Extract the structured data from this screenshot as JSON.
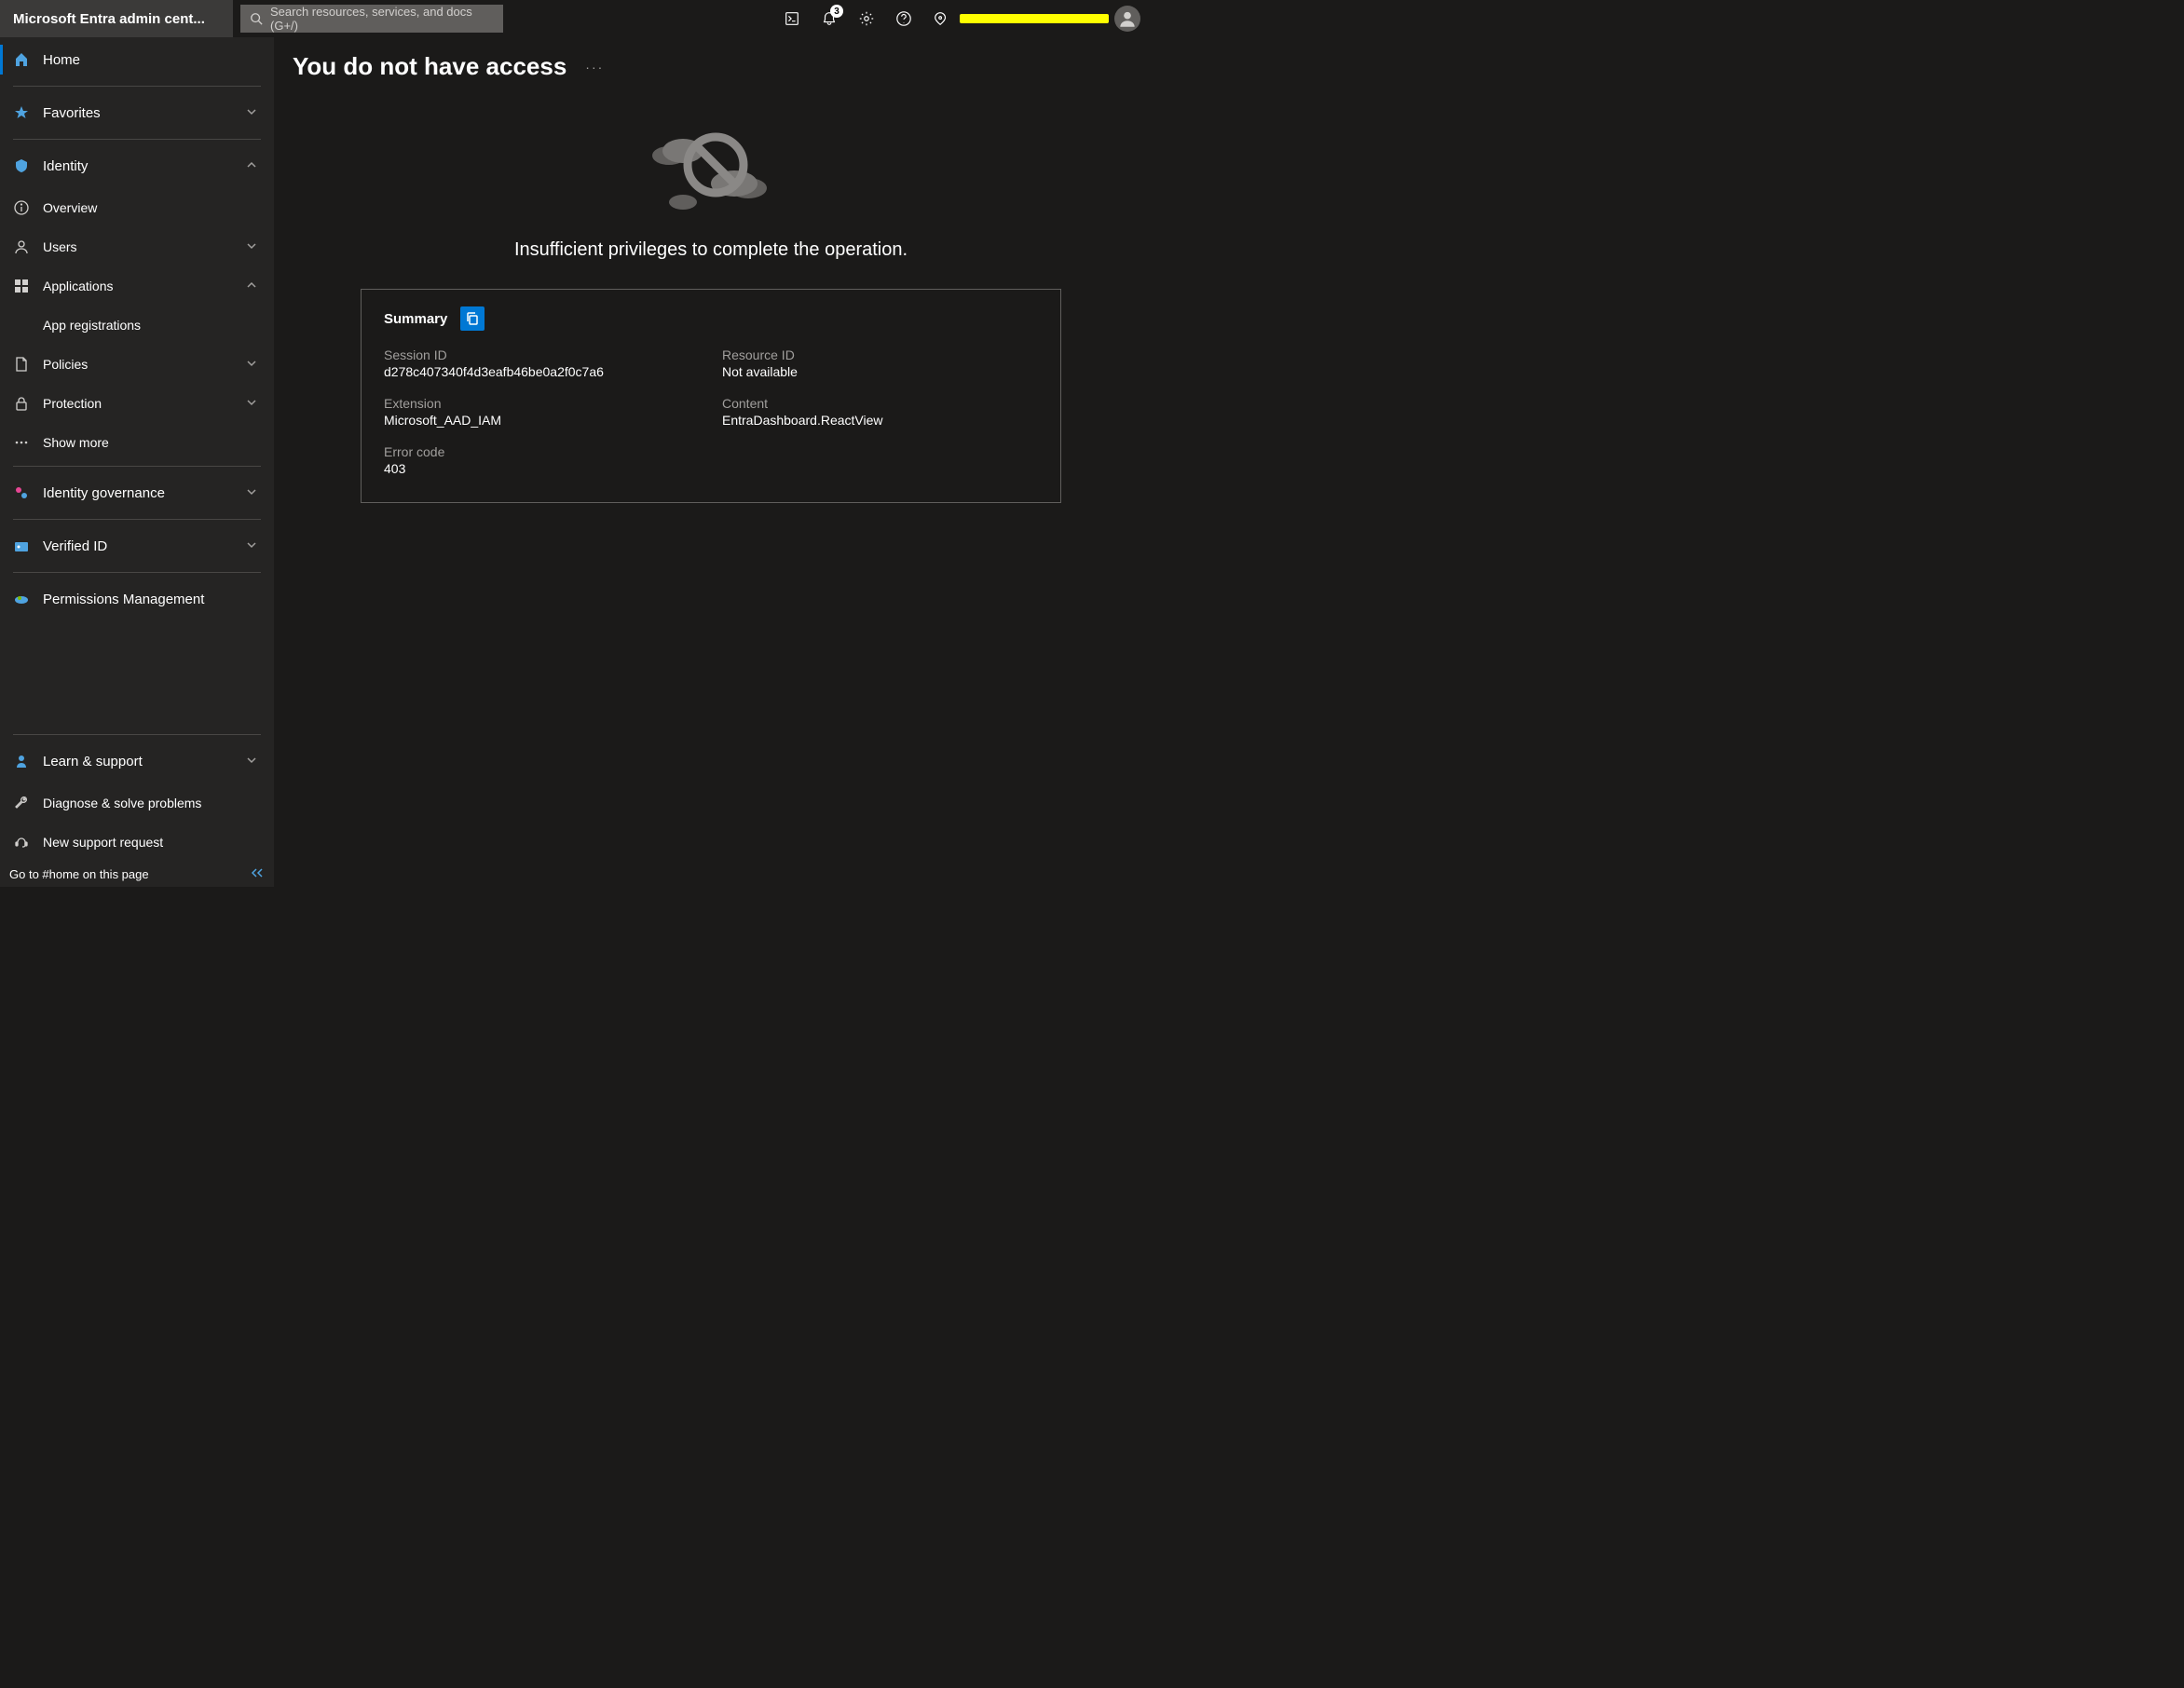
{
  "header": {
    "title": "Microsoft Entra admin cent...",
    "search_placeholder": "Search resources, services, and docs (G+/)",
    "notification_count": "3"
  },
  "sidebar": {
    "home": "Home",
    "favorites": "Favorites",
    "identity": {
      "label": "Identity",
      "overview": "Overview",
      "users": "Users",
      "applications": "Applications",
      "app_registrations": "App registrations",
      "policies": "Policies",
      "protection": "Protection",
      "show_more": "Show more"
    },
    "identity_governance": "Identity governance",
    "verified_id": "Verified ID",
    "permissions_management": "Permissions Management",
    "learn_support": "Learn & support",
    "diagnose": "Diagnose & solve problems",
    "new_support": "New support request",
    "footer_text": "Go to #home on this page"
  },
  "content": {
    "page_title": "You do not have access",
    "error_message": "Insufficient privileges to complete the operation.",
    "summary": {
      "title": "Summary",
      "session_id_label": "Session ID",
      "session_id_value": "d278c407340f4d3eafb46be0a2f0c7a6",
      "resource_id_label": "Resource ID",
      "resource_id_value": "Not available",
      "extension_label": "Extension",
      "extension_value": "Microsoft_AAD_IAM",
      "content_label": "Content",
      "content_value": "EntraDashboard.ReactView",
      "error_code_label": "Error code",
      "error_code_value": "403"
    }
  }
}
